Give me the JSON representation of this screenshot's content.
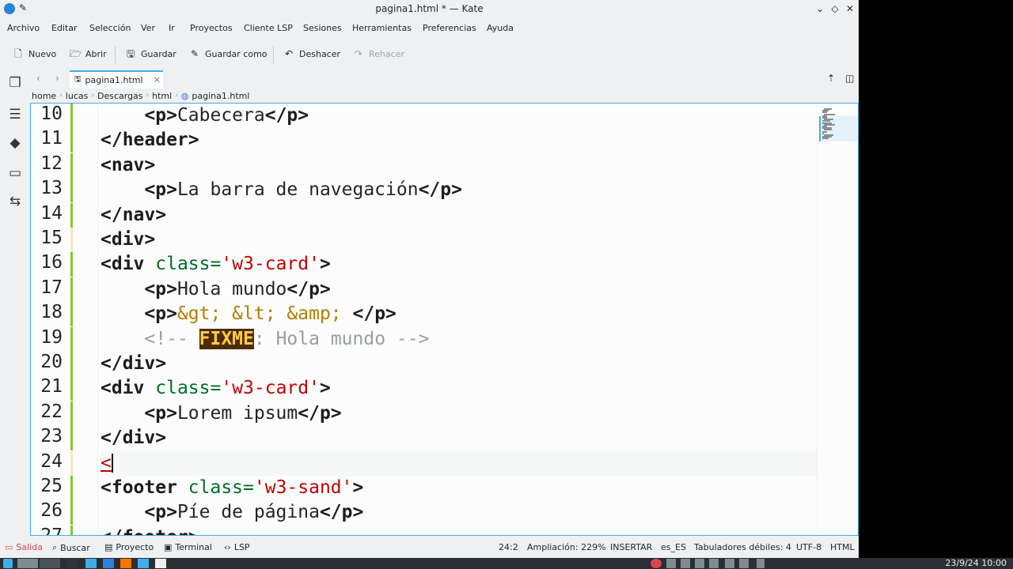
{
  "window": {
    "title": "pagina1.html * — Kate",
    "minimize_glyph": "⌄",
    "keep_above_glyph": "◇",
    "close_glyph": "✕"
  },
  "menu": [
    "Archivo",
    "Editar",
    "Selección",
    "Ver",
    "Ir",
    "Proyectos",
    "Cliente LSP",
    "Sesiones",
    "Herramientas",
    "Preferencias",
    "Ayuda"
  ],
  "toolbar": {
    "new_label": "Nuevo",
    "open_label": "Abrir",
    "save_label": "Guardar",
    "save_as_label": "Guardar como",
    "undo_label": "Deshacer",
    "redo_label": "Rehacer"
  },
  "tabs": [
    {
      "label": "pagina1.html",
      "close": "✕"
    }
  ],
  "breadcrumb": [
    "home",
    "lucas",
    "Descargas",
    "html",
    "pagina1.html"
  ],
  "editor": {
    "lines": [
      {
        "n": "10",
        "tokens": [
          {
            "t": "    ",
            "c": "ptext"
          },
          {
            "t": "<p>",
            "c": "tag"
          },
          {
            "t": "Cabecera",
            "c": "ptext"
          },
          {
            "t": "</p>",
            "c": "tag"
          }
        ]
      },
      {
        "n": "11",
        "tokens": [
          {
            "t": "</header>",
            "c": "tag"
          }
        ]
      },
      {
        "n": "12",
        "tokens": [
          {
            "t": "<nav>",
            "c": "tag"
          }
        ]
      },
      {
        "n": "13",
        "tokens": [
          {
            "t": "    ",
            "c": "ptext"
          },
          {
            "t": "<p>",
            "c": "tag"
          },
          {
            "t": "La barra de navegación",
            "c": "ptext"
          },
          {
            "t": "</p>",
            "c": "tag"
          }
        ]
      },
      {
        "n": "14",
        "tokens": [
          {
            "t": "</nav>",
            "c": "tag"
          }
        ]
      },
      {
        "n": "15",
        "tokens": [
          {
            "t": "<div>",
            "c": "tag"
          }
        ]
      },
      {
        "n": "16",
        "tokens": [
          {
            "t": "<div ",
            "c": "tag"
          },
          {
            "t": "class=",
            "c": "attr"
          },
          {
            "t": "'w3-card'",
            "c": "str"
          },
          {
            "t": ">",
            "c": "tag"
          }
        ]
      },
      {
        "n": "17",
        "tokens": [
          {
            "t": "    ",
            "c": "ptext"
          },
          {
            "t": "<p>",
            "c": "tag"
          },
          {
            "t": "Hola mundo",
            "c": "ptext"
          },
          {
            "t": "</p>",
            "c": "tag"
          }
        ]
      },
      {
        "n": "18",
        "tokens": [
          {
            "t": "    ",
            "c": "ptext"
          },
          {
            "t": "<p>",
            "c": "tag"
          },
          {
            "t": "&gt; &lt; &amp;",
            "c": "ent"
          },
          {
            "t": " ",
            "c": "ptext"
          },
          {
            "t": "</p>",
            "c": "tag"
          }
        ]
      },
      {
        "n": "19",
        "tokens": [
          {
            "t": "    ",
            "c": "ptext"
          },
          {
            "t": "<!-- ",
            "c": "cmt"
          },
          {
            "t": "FIXME",
            "c": "fixme"
          },
          {
            "t": ": Hola mundo -->",
            "c": "cmt"
          }
        ]
      },
      {
        "n": "20",
        "tokens": [
          {
            "t": "</div>",
            "c": "tag"
          }
        ]
      },
      {
        "n": "21",
        "tokens": [
          {
            "t": "<div ",
            "c": "tag"
          },
          {
            "t": "class=",
            "c": "attr"
          },
          {
            "t": "'w3-card'",
            "c": "str"
          },
          {
            "t": ">",
            "c": "tag"
          }
        ]
      },
      {
        "n": "22",
        "tokens": [
          {
            "t": "    ",
            "c": "ptext"
          },
          {
            "t": "<p>",
            "c": "tag"
          },
          {
            "t": "Lorem ipsum",
            "c": "ptext"
          },
          {
            "t": "</p>",
            "c": "tag"
          }
        ]
      },
      {
        "n": "23",
        "tokens": [
          {
            "t": "</div>",
            "c": "tag"
          }
        ]
      },
      {
        "n": "24",
        "tokens": [
          {
            "t": "<",
            "c": "cursor-lt"
          }
        ],
        "current": true
      },
      {
        "n": "25",
        "tokens": [
          {
            "t": "<footer ",
            "c": "tag"
          },
          {
            "t": "class=",
            "c": "attr"
          },
          {
            "t": "'w3-sand'",
            "c": "str"
          },
          {
            "t": ">",
            "c": "tag"
          }
        ]
      },
      {
        "n": "26",
        "tokens": [
          {
            "t": "    ",
            "c": "ptext"
          },
          {
            "t": "<p>",
            "c": "tag"
          },
          {
            "t": "Píe de página",
            "c": "ptext"
          },
          {
            "t": "</p>",
            "c": "tag"
          }
        ]
      },
      {
        "n": "27",
        "tokens": [
          {
            "t": "</footer>",
            "c": "tag"
          }
        ]
      }
    ],
    "modified_lines": [
      "15",
      "24"
    ]
  },
  "statusbar": {
    "output_label": "Salida",
    "search_label": "Buscar",
    "project_label": "Proyecto",
    "terminal_label": "Terminal",
    "lsp_label": "LSP",
    "position": "24:2",
    "zoom": "Ampliación: 229%",
    "mode": "INSERTAR",
    "language": "es_ES",
    "indent": "Tabuladores débiles: 4",
    "encoding": "UTF-8",
    "syntax": "HTML"
  },
  "taskbar": {
    "clock": "23/9/24  10:00"
  },
  "colors": {
    "accent": "#3daee9",
    "tag": "#1f1c1b",
    "attribute": "#006e28",
    "string": "#bf0303",
    "entity": "#b08000",
    "comment": "#9a9ea2",
    "modified_saved": "#81ca2d",
    "modified_unsaved": "#f7e6c5"
  }
}
